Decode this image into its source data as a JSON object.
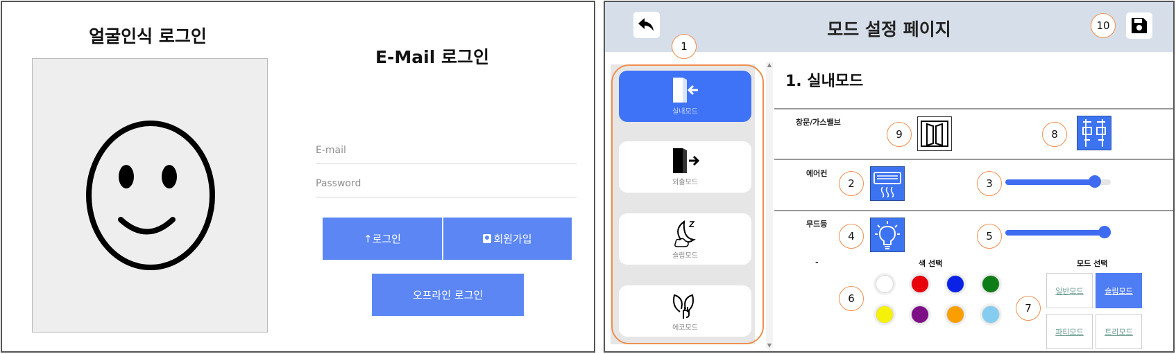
{
  "left": {
    "face_title": "얼굴인식 로그인",
    "email_title": "E-Mail 로그인",
    "email_placeholder": "E-mail",
    "password_placeholder": "Password",
    "login_label": "↑로그인",
    "signup_label": "회원가입",
    "offline_login_label": "오프라인 로그인",
    "colors": {
      "button": "#5b86f3",
      "face_box": "#eeeeee"
    }
  },
  "right": {
    "header_title": "모드 설정 페이지",
    "section_title": "1. 실내모드",
    "sidebar_modes": [
      {
        "label": "실내모드",
        "icon": "door-enter-icon",
        "active": true
      },
      {
        "label": "외출모드",
        "icon": "door-exit-icon",
        "active": false
      },
      {
        "label": "슬립모드",
        "icon": "moon-sleep-icon",
        "active": false
      },
      {
        "label": "에코모드",
        "icon": "eco-plug-icon",
        "active": false
      }
    ],
    "rows": {
      "window_label": "창문/가스밸브",
      "aircon_label": "에어컨",
      "mood_label": "무드등",
      "dash_label": "-"
    },
    "sliders": {
      "aircon_level": 0.85,
      "mood_level": 1.0
    },
    "color_select_label": "색 선택",
    "mode_select_label": "모드 선택",
    "color_options": [
      "#ffffff",
      "#e8000b",
      "#0a22e6",
      "#0f7d17",
      "#f5f10a",
      "#7d0f87",
      "#fb9e00",
      "#84cdf0"
    ],
    "mood_modes": [
      {
        "label": "일반모드",
        "selected": false
      },
      {
        "label": "슬립모드",
        "selected": true
      },
      {
        "label": "파티모드",
        "selected": false
      },
      {
        "label": "트리모드",
        "selected": false
      }
    ],
    "callouts": [
      "1",
      "2",
      "3",
      "4",
      "5",
      "6",
      "7",
      "8",
      "9",
      "10"
    ],
    "colors": {
      "header": "#d6dee9",
      "active_mode": "#3f73f7",
      "callout_border": "#ef8f4f",
      "slider": "#3f6bf0"
    }
  }
}
